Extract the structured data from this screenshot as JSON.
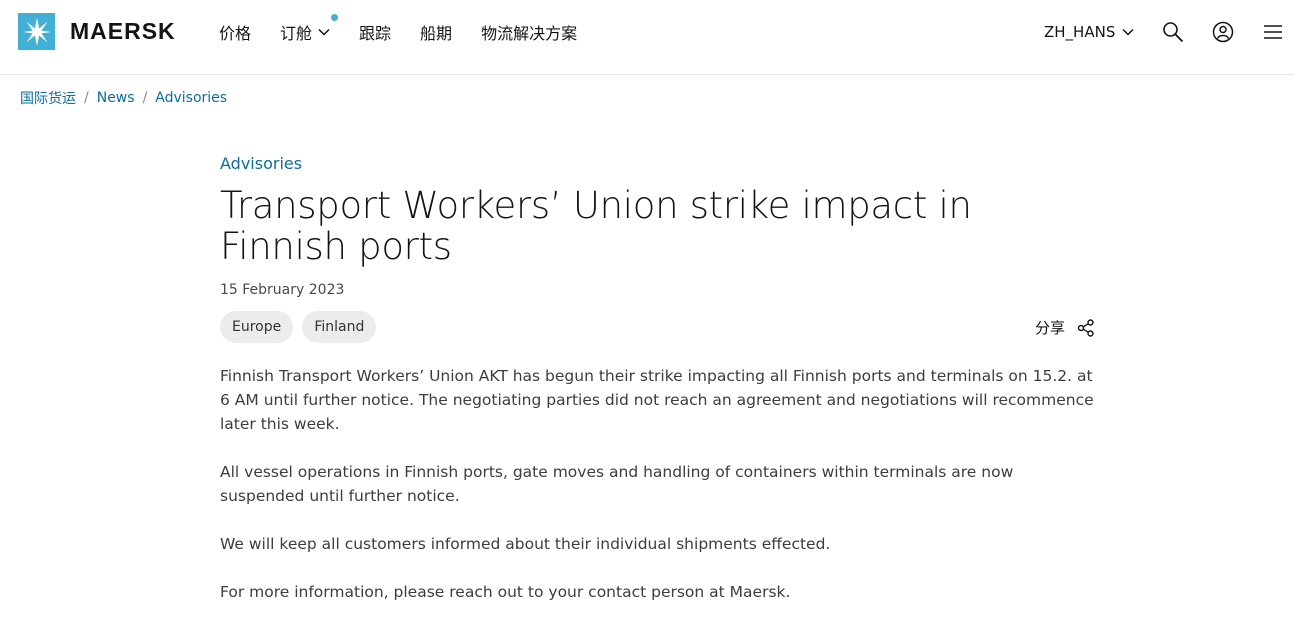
{
  "brand": {
    "name": "MAERSK",
    "color": "#42b0d5"
  },
  "nav": {
    "items": [
      {
        "label": "价格"
      },
      {
        "label": "订舱"
      },
      {
        "label": "跟踪"
      },
      {
        "label": "船期"
      },
      {
        "label": "物流解决方案"
      }
    ]
  },
  "header": {
    "language": "ZH_HANS",
    "icons": [
      "search-icon",
      "user-icon",
      "menu-icon"
    ]
  },
  "breadcrumb": {
    "items": [
      "国际货运",
      "News",
      "Advisories"
    ],
    "separator": "/"
  },
  "article": {
    "category": "Advisories",
    "title": "Transport Workers’ Union strike impact in Finnish ports",
    "date": "15 February 2023",
    "tags": [
      "Europe",
      "Finland"
    ],
    "share_label": "分享",
    "paragraphs": [
      "Finnish Transport Workers’ Union AKT has begun their strike impacting all Finnish ports and terminals on 15.2. at 6 AM until further notice. The negotiating parties did not reach an agreement and negotiations will recommence later this week.",
      "All vessel operations in Finnish ports, gate moves and handling of containers within terminals are now suspended until further notice.",
      "We will keep all customers informed about their individual shipments effected.",
      "For more information, please reach out to your contact person at Maersk."
    ]
  },
  "colors": {
    "link": "#0b6e9c",
    "accent": "#42b0d5",
    "tag_bg": "#ececec"
  }
}
